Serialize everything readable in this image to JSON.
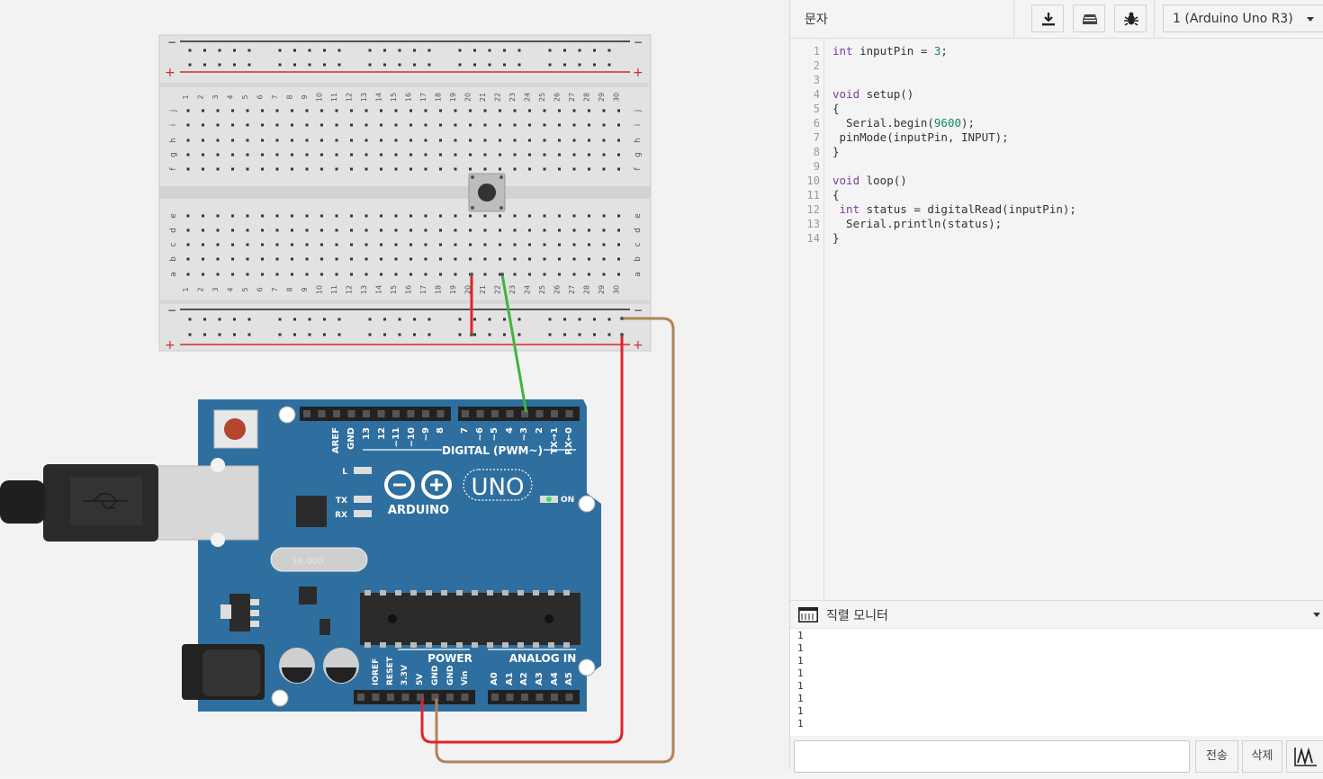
{
  "toolbar": {
    "mode_label": "문자",
    "download_icon": "download-icon",
    "upload_icon": "upload-icon",
    "debug_icon": "bug-icon",
    "device_select": "1 (Arduino Uno R3)"
  },
  "code": {
    "lines": [
      {
        "n": "1",
        "html": "<span class=\"kw\">int</span> inputPin = <span class=\"num\">3</span>;"
      },
      {
        "n": "2",
        "html": ""
      },
      {
        "n": "3",
        "html": ""
      },
      {
        "n": "4",
        "html": "<span class=\"kw\">void</span> setup()"
      },
      {
        "n": "5",
        "html": "{"
      },
      {
        "n": "6",
        "html": "  Serial.begin(<span class=\"num\">9600</span>);"
      },
      {
        "n": "7",
        "html": " pinMode(inputPin, INPUT);"
      },
      {
        "n": "8",
        "html": "}"
      },
      {
        "n": "9",
        "html": ""
      },
      {
        "n": "10",
        "html": "<span class=\"kw\">void</span> loop()"
      },
      {
        "n": "11",
        "html": "{"
      },
      {
        "n": "12",
        "html": " <span class=\"kw\">int</span> status = digitalRead(inputPin);"
      },
      {
        "n": "13",
        "html": "  Serial.println(status);"
      },
      {
        "n": "14",
        "html": "}"
      }
    ]
  },
  "serial_monitor": {
    "title": "직렬 모니터",
    "output": [
      "1",
      "1",
      "1",
      "1",
      "1",
      "1",
      "1",
      "1"
    ],
    "send_label": "전송",
    "clear_label": "삭제",
    "graph_icon": "waveform-icon"
  },
  "breadboard": {
    "columns": [
      "1",
      "2",
      "3",
      "4",
      "5",
      "6",
      "7",
      "8",
      "9",
      "10",
      "11",
      "12",
      "13",
      "14",
      "15",
      "16",
      "17",
      "18",
      "19",
      "20",
      "21",
      "22",
      "23",
      "24",
      "25",
      "26",
      "27",
      "28",
      "29",
      "30"
    ],
    "top_rows": [
      "j",
      "i",
      "h",
      "g",
      "f"
    ],
    "bottom_rows": [
      "e",
      "d",
      "c",
      "b",
      "a"
    ],
    "rail_minus": "−",
    "rail_plus": "+"
  },
  "arduino": {
    "header_digital_top": [
      "AREF",
      "GND",
      "13",
      "12",
      "~11",
      "~10",
      "~9",
      "8"
    ],
    "header_digital_bottom": [
      "7",
      "~6",
      "~5",
      "4",
      "~3",
      "2",
      "TX→1",
      "RX←0"
    ],
    "digital_label": "DIGITAL (PWM~)",
    "brand": "ARDUINO",
    "model": "UNO",
    "led_l": "L",
    "led_tx": "TX",
    "led_rx": "RX",
    "on_label": "ON",
    "crystal": "16.000",
    "power_label": "POWER",
    "analog_label": "ANALOG IN",
    "power_pins": [
      "IOREF",
      "RESET",
      "3.3V",
      "5V",
      "GND",
      "GND",
      "Vin"
    ],
    "analog_pins": [
      "A0",
      "A1",
      "A2",
      "A3",
      "A4",
      "A5"
    ]
  },
  "colors": {
    "board": "#2f6f9f",
    "wire_red": "#e0242a",
    "wire_green": "#3db53d",
    "wire_brown": "#b0835a",
    "rail_red": "#d8282e"
  }
}
